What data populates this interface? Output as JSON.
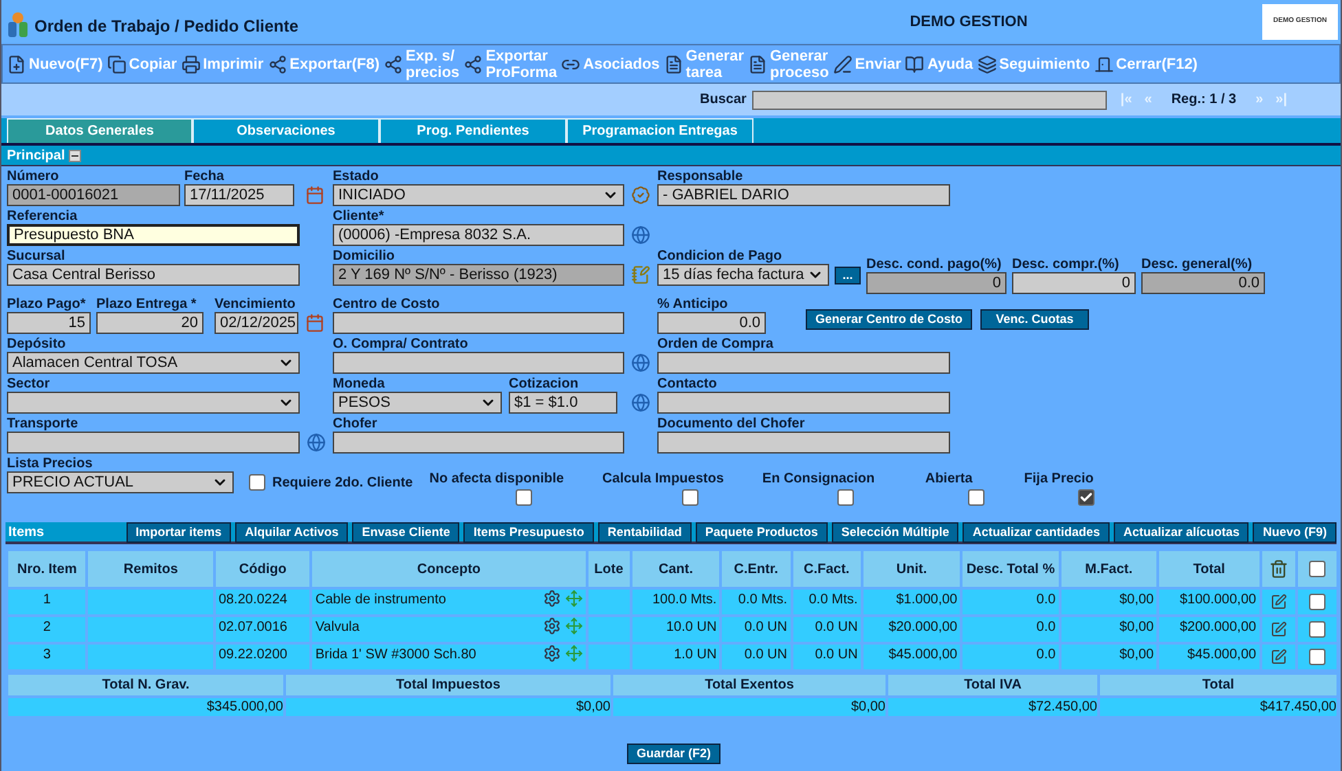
{
  "header": {
    "title": "Orden de Trabajo / Pedido Cliente",
    "company": "DEMO GESTION",
    "logo_text": "DEMO GESTION"
  },
  "toolbar": [
    {
      "label": "Nuevo(F7)"
    },
    {
      "label": "Copiar"
    },
    {
      "label": "Imprimir"
    },
    {
      "label": "Exportar(F8)"
    },
    {
      "label": "Exp. s/\nprecios"
    },
    {
      "label": "Exportar\nProForma"
    },
    {
      "label": "Asociados"
    },
    {
      "label": "Generar\ntarea"
    },
    {
      "label": "Generar\nproceso"
    },
    {
      "label": "Enviar"
    },
    {
      "label": "Ayuda"
    },
    {
      "label": "Seguimiento"
    },
    {
      "label": "Cerrar(F12)"
    }
  ],
  "search": {
    "label": "Buscar",
    "record": "Reg.: 1 / 3",
    "nav": [
      "|«",
      "«",
      "»",
      "»|"
    ]
  },
  "tabs": [
    {
      "label": "Datos Generales",
      "selected": true
    },
    {
      "label": "Observaciones",
      "selected": false
    },
    {
      "label": "Prog. Pendientes",
      "selected": false
    },
    {
      "label": "Programacion Entregas",
      "selected": false
    }
  ],
  "section": {
    "title": "Principal",
    "expanded": true
  },
  "fields": {
    "numero": {
      "label": "Número",
      "value": "0001-00016021"
    },
    "fecha": {
      "label": "Fecha",
      "value": "17/11/2025"
    },
    "estado": {
      "label": "Estado",
      "value": "INICIADO"
    },
    "responsable": {
      "label": "Responsable",
      "value": "- GABRIEL DARIO"
    },
    "referencia": {
      "label": "Referencia",
      "value": "Presupuesto BNA"
    },
    "cliente": {
      "label": "Cliente*",
      "value": "(00006) -Empresa 8032 S.A."
    },
    "sucursal": {
      "label": "Sucursal",
      "value": "Casa Central Berisso"
    },
    "domicilio": {
      "label": "Domicilio",
      "value": "2 Y 169 Nº S/Nº - Berisso (1923)"
    },
    "condicion_pago": {
      "label": "Condicion de Pago",
      "value": "15 días fecha factura"
    },
    "desc_cond_pago": {
      "label": "Desc. cond. pago(%)",
      "value": "0"
    },
    "desc_compr": {
      "label": "Desc. compr.(%)",
      "value": "0"
    },
    "desc_general": {
      "label": "Desc. general(%)",
      "value": "0.0"
    },
    "plazo_pago": {
      "label": "Plazo Pago*",
      "value": "15"
    },
    "plazo_entrega": {
      "label": "Plazo Entrega *",
      "value": "20"
    },
    "vencimiento": {
      "label": "Vencimiento",
      "value": "02/12/2025"
    },
    "centro_costo": {
      "label": "Centro de Costo"
    },
    "anticipo": {
      "label": "% Anticipo",
      "value": "0.0"
    },
    "deposito": {
      "label": "Depósito",
      "value": "Alamacen Central TOSA"
    },
    "o_compra": {
      "label": "O. Compra/ Contrato"
    },
    "orden_compra": {
      "label": "Orden de Compra"
    },
    "sector": {
      "label": "Sector"
    },
    "moneda": {
      "label": "Moneda",
      "value": "PESOS"
    },
    "cotizacion": {
      "label": "Cotizacion",
      "value": "$1 = $1.0"
    },
    "contacto": {
      "label": "Contacto"
    },
    "transporte": {
      "label": "Transporte"
    },
    "chofer": {
      "label": "Chofer"
    },
    "doc_chofer": {
      "label": "Documento del Chofer"
    },
    "lista_precios": {
      "label": "Lista Precios",
      "value": "PRECIO ACTUAL"
    }
  },
  "more_button": "...",
  "form_buttons": [
    "Generar Centro de Costo",
    "Venc. Cuotas"
  ],
  "flags": [
    {
      "label": "Requiere 2do. Cliente",
      "checked": false,
      "kind": "inline"
    },
    {
      "label": "No afecta disponible",
      "checked": false,
      "kind": "stacked"
    },
    {
      "label": "Calcula Impuestos",
      "checked": false,
      "kind": "stacked"
    },
    {
      "label": "En Consignacion",
      "checked": false,
      "kind": "stacked"
    },
    {
      "label": "Abierta",
      "checked": false,
      "kind": "stacked"
    },
    {
      "label": "Fija Precio",
      "checked": true,
      "kind": "stacked"
    }
  ],
  "items": {
    "title": "Items",
    "buttons": [
      "Importar items",
      "Alquilar Activos",
      "Envase Cliente",
      "Items Presupuesto",
      "Rentabilidad",
      "Paquete Productos",
      "Selección Múltiple",
      "Actualizar cantidades",
      "Actualizar alícuotas",
      "Nuevo (F9)"
    ],
    "columns": [
      "Nro. Item",
      "Remitos",
      "Código",
      "Concepto",
      "Lote",
      "Cant.",
      "C.Entr.",
      "C.Fact.",
      "Unit.",
      "Desc. Total %",
      "M.Fact.",
      "Total"
    ],
    "header_checked": false,
    "rows": [
      {
        "cells": [
          "1",
          "",
          "08.20.0224",
          "Cable de instrumento",
          "",
          "100.0 Mts.",
          "0.0 Mts.",
          "0.0 Mts.",
          "$1.000,00",
          "0.0",
          "$0,00",
          "$100.000,00"
        ],
        "checked": false
      },
      {
        "cells": [
          "2",
          "",
          "02.07.0016",
          "Valvula",
          "",
          "10.0 UN",
          "0.0 UN",
          "0.0 UN",
          "$20.000,00",
          "0.0",
          "$0,00",
          "$200.000,00"
        ],
        "checked": false
      },
      {
        "cells": [
          "3",
          "",
          "09.22.0200",
          "Brida 1' SW #3000 Sch.80",
          "",
          "1.0 UN",
          "0.0 UN",
          "0.0 UN",
          "$45.000,00",
          "0.0",
          "$0,00",
          "$45.000,00"
        ],
        "checked": false
      }
    ]
  },
  "totals": {
    "columns": [
      "Total N. Grav.",
      "Total Impuestos",
      "Total Exentos",
      "Total IVA",
      "Total"
    ],
    "values": [
      "$345.000,00",
      "$0,00",
      "$0,00",
      "$72.450,00",
      "$417.450,00"
    ]
  },
  "save_button": "Guardar (F2)"
}
